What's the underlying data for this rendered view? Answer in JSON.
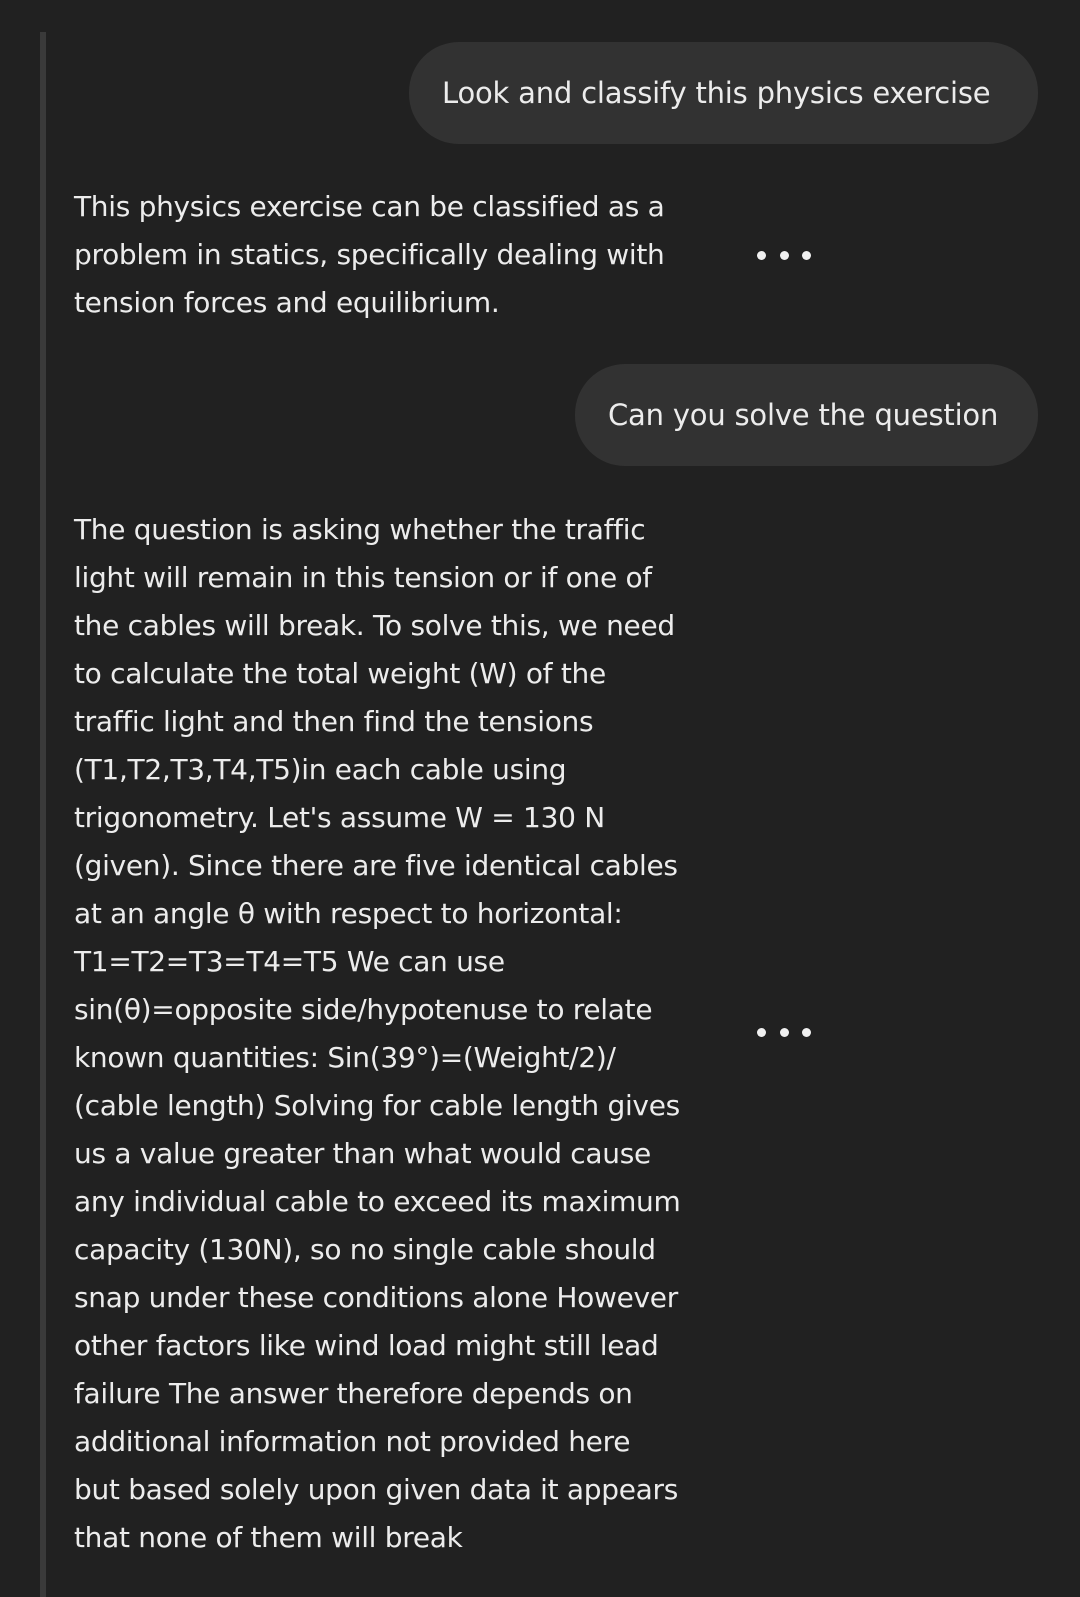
{
  "conversation": {
    "messages": [
      {
        "role": "user",
        "text": "Look and classify this physics exercise"
      },
      {
        "role": "assistant",
        "text": "This physics exercise can be classified as a\nproblem in statics, specifically dealing with\ntension forces and equilibrium."
      },
      {
        "role": "user",
        "text": "Can you solve the question"
      },
      {
        "role": "assistant",
        "text": "The question is asking whether the traffic\nlight will remain in this tension or if one of\nthe cables will break. To solve this, we need\nto calculate the total weight (W) of the\ntraffic light and then find the tensions\n(T1,T2,T3,T4,T5)in each cable using\ntrigonometry. Let's assume W = 130 N\n(given). Since there are five identical cables\nat an angle θ with respect to horizontal:\nT1=T2=T3=T4=T5 We can use\nsin(θ)=opposite side/hypotenuse to relate\nknown quantities: Sin(39°)=(Weight/2)/\n(cable length) Solving for cable length gives\nus a value greater than what would cause\nany individual cable to exceed its maximum\ncapacity (130N), so no single cable should\nsnap under these conditions alone However\nother factors like wind load might still lead\nfailure The answer therefore depends on\nadditional information not provided here\nbut based solely upon given data it appears\nthat none of them will break"
      }
    ],
    "icons": {
      "more": "more-options-icon"
    }
  },
  "colors": {
    "background": "#212121",
    "user_bubble": "#323232",
    "text": "#ececec"
  }
}
